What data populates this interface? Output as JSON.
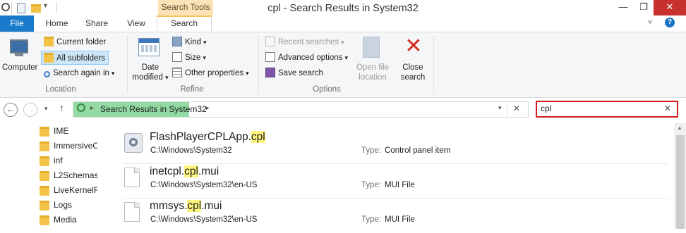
{
  "window": {
    "title": "cpl - Search Results in System32",
    "context_tab": "Search Tools",
    "minimize": "—",
    "maximize": "❐",
    "close": "✕"
  },
  "tabs": {
    "file": "File",
    "home": "Home",
    "share": "Share",
    "view": "View",
    "search": "Search"
  },
  "ribbon": {
    "location": {
      "computer": "Computer",
      "current_folder": "Current folder",
      "all_subfolders": "All subfolders",
      "search_again_in": "Search again in",
      "label": "Location"
    },
    "refine": {
      "date_modified_1": "Date",
      "date_modified_2": "modified",
      "kind": "Kind",
      "size": "Size",
      "other_properties": "Other properties",
      "label": "Refine"
    },
    "options": {
      "recent_searches": "Recent searches",
      "advanced_options": "Advanced options",
      "save_search": "Save search",
      "open_file_location_1": "Open file",
      "open_file_location_2": "location",
      "close_search_1": "Close",
      "close_search_2": "search",
      "label": "Options"
    }
  },
  "address": {
    "breadcrumb": "Search Results in System32",
    "search_value": "cpl"
  },
  "tree": [
    "IME",
    "ImmersiveC",
    "inf",
    "L2Schemas",
    "LiveKernelR",
    "Logs",
    "Media"
  ],
  "results": [
    {
      "name_pre": "FlashPlayerCPLApp.",
      "name_hl": "cpl",
      "name_post": "",
      "path": "C:\\Windows\\System32",
      "type_label": "Type:",
      "type": "Control panel item"
    },
    {
      "name_pre": "inetcpl.",
      "name_hl": "cpl",
      "name_post": ".mui",
      "path": "C:\\Windows\\System32\\en-US",
      "type_label": "Type:",
      "type": "MUI File"
    },
    {
      "name_pre": "mmsys.",
      "name_hl": "cpl",
      "name_post": ".mui",
      "path": "C:\\Windows\\System32\\en-US",
      "type_label": "Type:",
      "type": "MUI File"
    }
  ],
  "colors": {
    "file_tab": "#1979ca",
    "context_tab": "#fbe3b6",
    "highlight": "#fdf47e",
    "progress": "#93d9a3",
    "search_border": "#d71920",
    "close_button": "#c7302c"
  }
}
